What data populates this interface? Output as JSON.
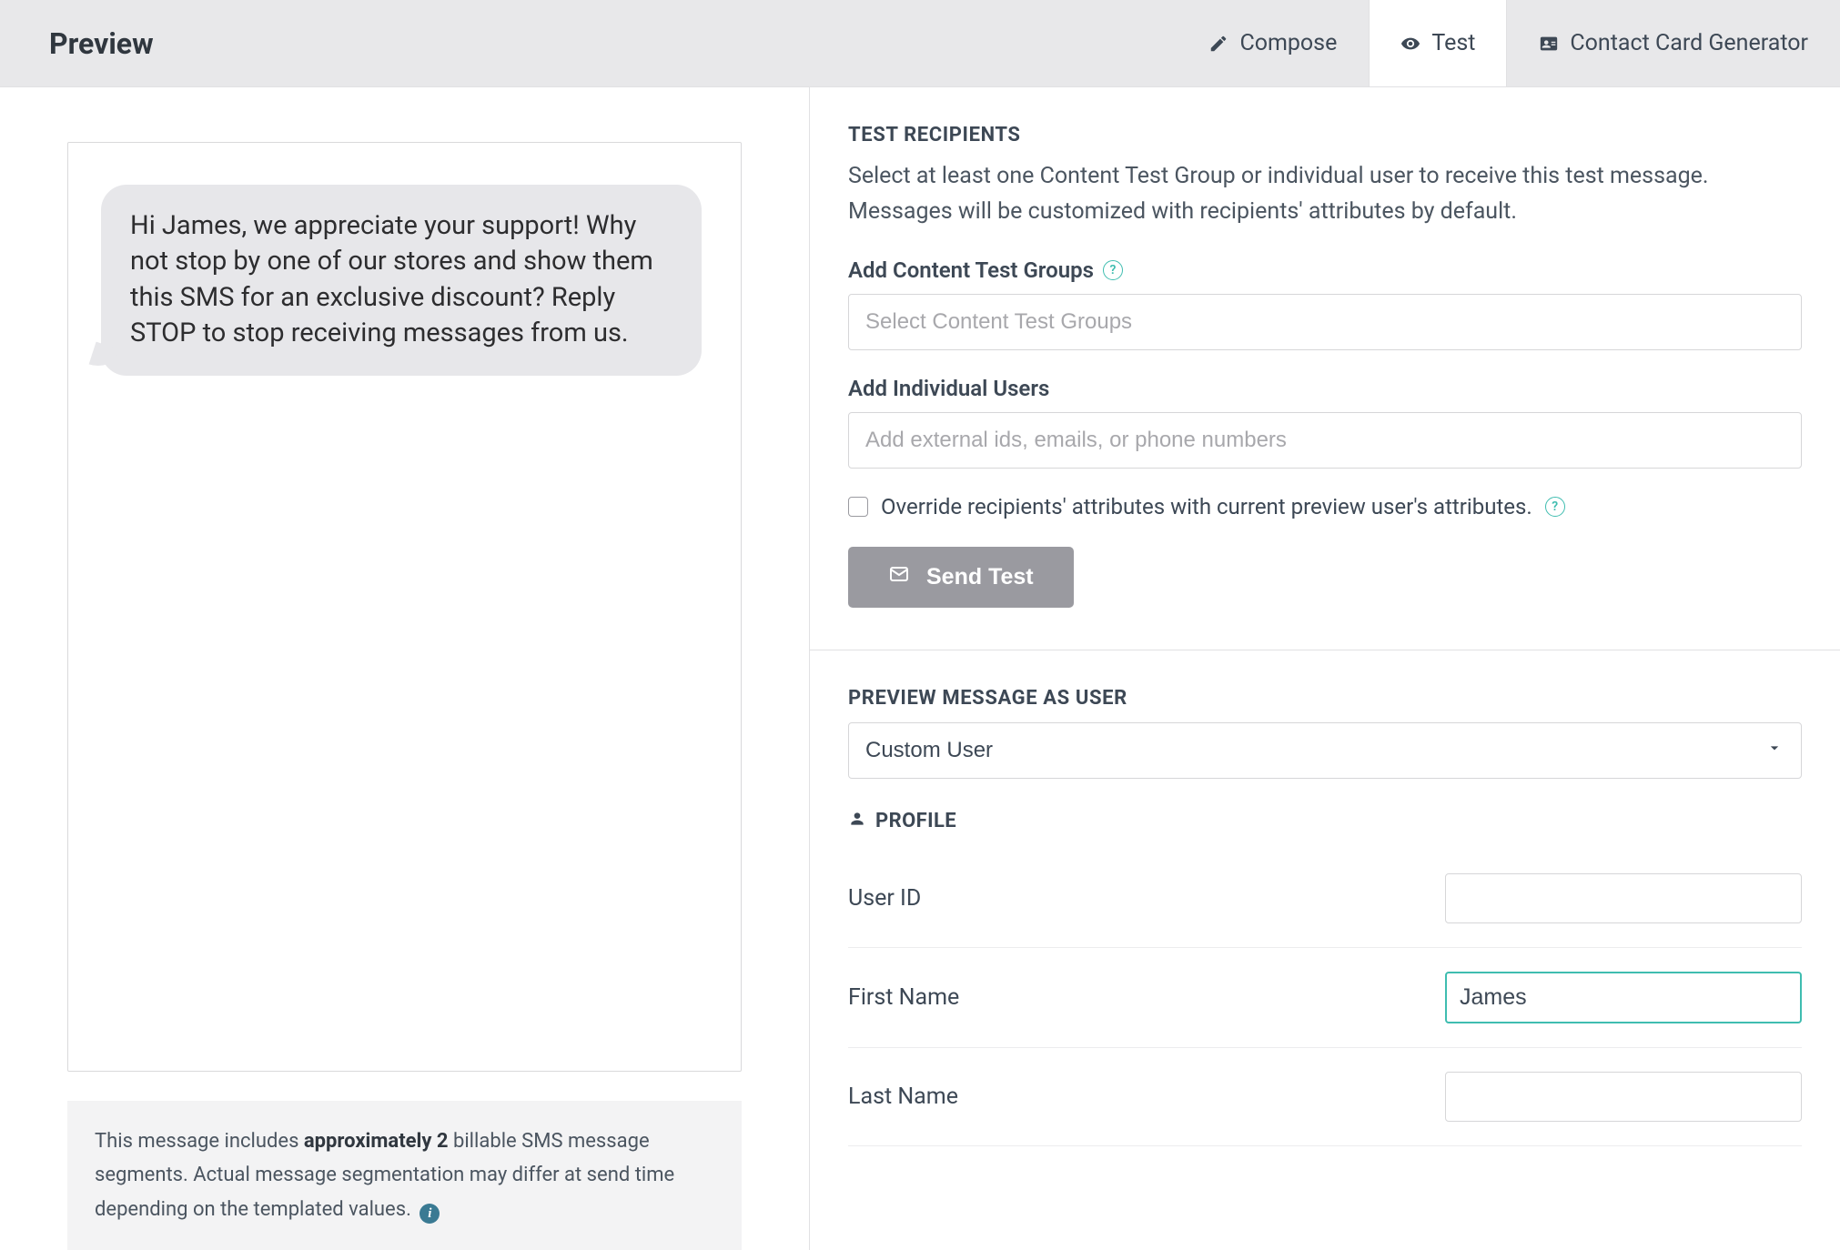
{
  "header": {
    "title": "Preview",
    "tabs": {
      "compose": "Compose",
      "test": "Test",
      "contact_card": "Contact Card Generator"
    }
  },
  "preview": {
    "bubble_text": "Hi James, we appreciate your support! Why not stop by one of our stores and show them this SMS for an exclusive discount? Reply STOP to stop receiving messages from us.",
    "segments_note_pre": "This message includes ",
    "segments_note_bold": "approximately 2",
    "segments_note_post": " billable SMS message segments. Actual message segmentation may differ at send time depending on the templated values."
  },
  "test": {
    "heading": "TEST RECIPIENTS",
    "subtext": "Select at least one Content Test Group or individual user to receive this test message. Messages will be customized with recipients' attributes by default.",
    "groups_label": "Add Content Test Groups",
    "groups_placeholder": "Select Content Test Groups",
    "users_label": "Add Individual Users",
    "users_placeholder": "Add external ids, emails, or phone numbers",
    "override_label": "Override recipients' attributes with current preview user's attributes.",
    "send_label": "Send Test"
  },
  "preview_as": {
    "heading": "PREVIEW MESSAGE AS USER",
    "select_value": "Custom User",
    "profile_heading": "PROFILE",
    "fields": {
      "user_id": {
        "label": "User ID",
        "value": ""
      },
      "first_name": {
        "label": "First Name",
        "value": "James"
      },
      "last_name": {
        "label": "Last Name",
        "value": ""
      }
    }
  }
}
